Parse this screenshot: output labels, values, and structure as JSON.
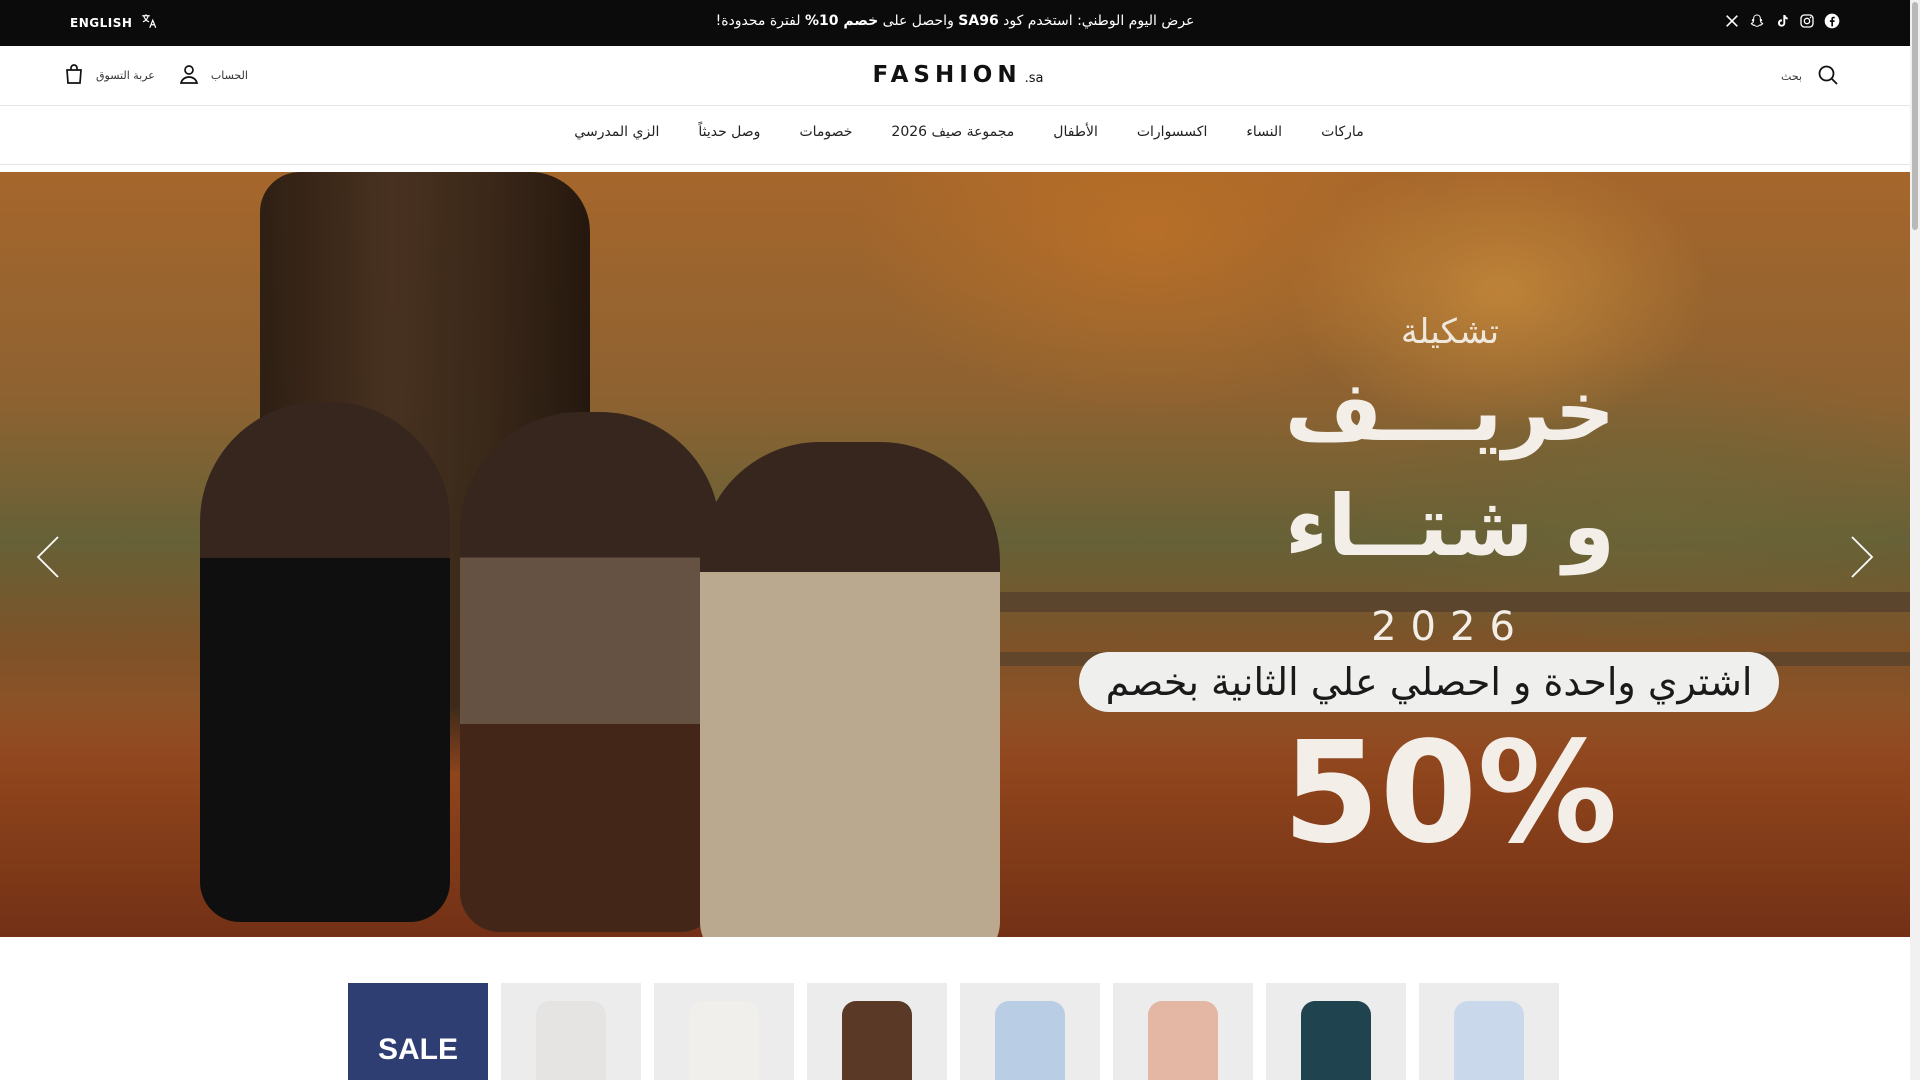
{
  "announcement": {
    "language_label": "ENGLISH",
    "promo_pre": "عرض اليوم الوطني: استخدم كود ",
    "promo_code": "SA96",
    "promo_mid": " واحصل على ",
    "promo_discount": "خصم 10%",
    "promo_post": " لفترة محدودة!",
    "socials": [
      "facebook-icon",
      "instagram-icon",
      "tiktok-icon",
      "snapchat-icon",
      "x-icon"
    ]
  },
  "header": {
    "logo_main": "FASHION",
    "logo_tld": ".sa",
    "cart_label": "عربة التسوق",
    "account_label": "الحساب",
    "search_label": "بحث"
  },
  "nav": {
    "items": [
      "ماركات",
      "النساء",
      "اكسسوارات",
      "الأطفال",
      "مجموعة صيف 2026",
      "خصومات",
      "وصل حديثاً",
      "الزي المدرسي"
    ]
  },
  "hero": {
    "kicker": "تشكيلة",
    "line1": "خريـــف",
    "line2": "و شتــاء",
    "year": "2026",
    "offer": "اشتري واحدة و احصلي علي الثانية بخصم",
    "percent": "50%"
  },
  "thumbnails": {
    "sale_label": "SALE",
    "colors": [
      "#2e3e72",
      "#e6e4e2",
      "#f1efeb",
      "#5a3a27",
      "#b9cde4",
      "#e4b7a4",
      "#1f4450",
      "#c9d8ea"
    ]
  }
}
